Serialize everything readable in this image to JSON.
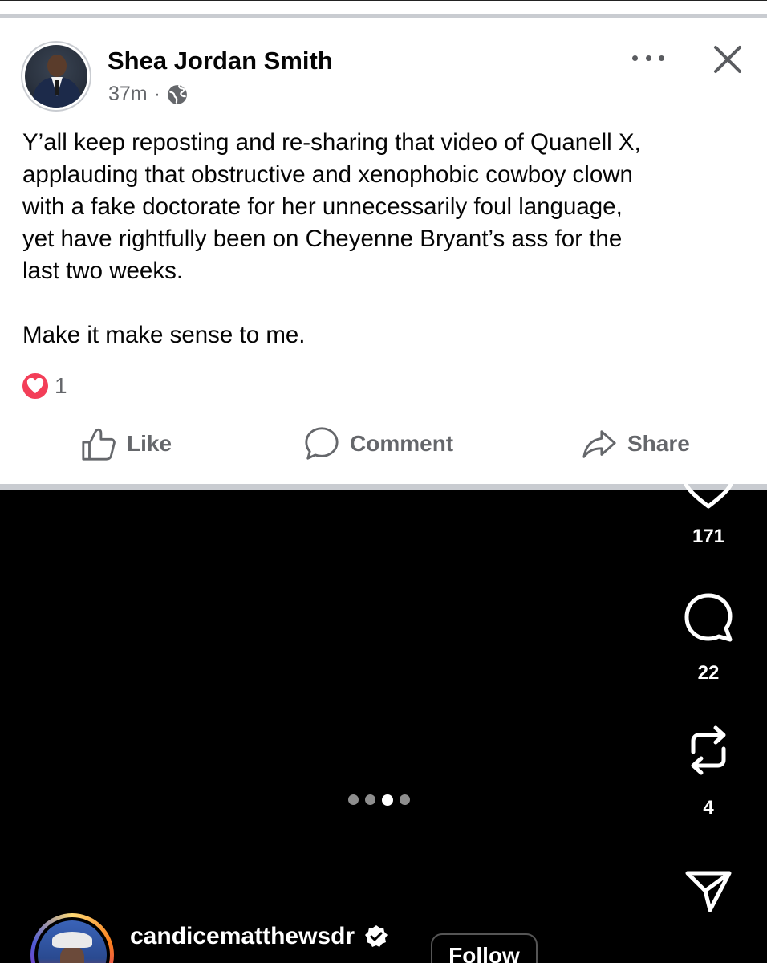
{
  "fb_post": {
    "author": "Shea Jordan Smith",
    "time": "37m",
    "separator": "·",
    "body": "Y’all keep reposting and re-sharing that video of Quanell X,\napplauding that obstructive and xenophobic cowboy clown\nwith a fake doctorate for her unnecessarily foul language,\nyet have rightfully been on Cheyenne Bryant’s ass for the\nlast two weeks.\n\nMake it make sense to me.",
    "reaction_count": "1",
    "actions": {
      "like": "Like",
      "comment": "Comment",
      "share": "Share"
    }
  },
  "ig_reel": {
    "likes": "171",
    "comments": "22",
    "reposts": "4",
    "carousel": {
      "count": 4,
      "active_index": 2
    },
    "username": "candicematthewsdr",
    "follow_label": "Follow"
  },
  "colors": {
    "fb_text": "#050505",
    "fb_muted": "#65676b",
    "love_reaction": "#f33e58",
    "divider": "#c9ccd1"
  },
  "icons": [
    "globe-icon",
    "more-icon",
    "close-icon",
    "heart-reaction-icon",
    "like-icon",
    "comment-icon",
    "share-icon",
    "heart-icon",
    "comment-bubble-icon",
    "repost-icon",
    "send-icon",
    "verified-badge-icon"
  ]
}
